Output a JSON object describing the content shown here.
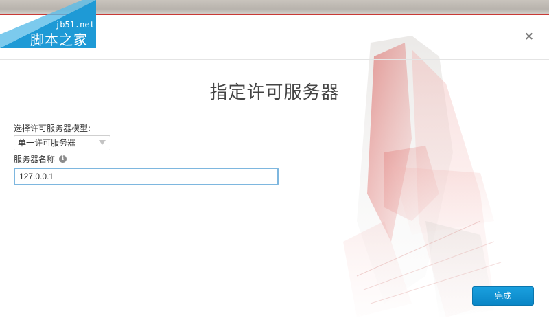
{
  "dialog": {
    "title": "指定许可服务器",
    "close_label": "×"
  },
  "license_model": {
    "label": "选择许可服务器模型:",
    "selected": "单一许可服务器"
  },
  "server_name": {
    "label": "服务器名称",
    "info_glyph": "i",
    "value": "127.0.0.1"
  },
  "footer": {
    "finish_label": "完成"
  },
  "watermark": {
    "site": "jb51.net",
    "name": "脚本之家"
  },
  "colors": {
    "accent": "#0a86c6",
    "input_focus": "#7eb7df",
    "brand_red": "#c93a36",
    "watermark_blue": "#1e9ad6"
  },
  "icons": {
    "close": "close-icon",
    "info": "info-icon",
    "dropdown": "chevron-down-icon"
  }
}
